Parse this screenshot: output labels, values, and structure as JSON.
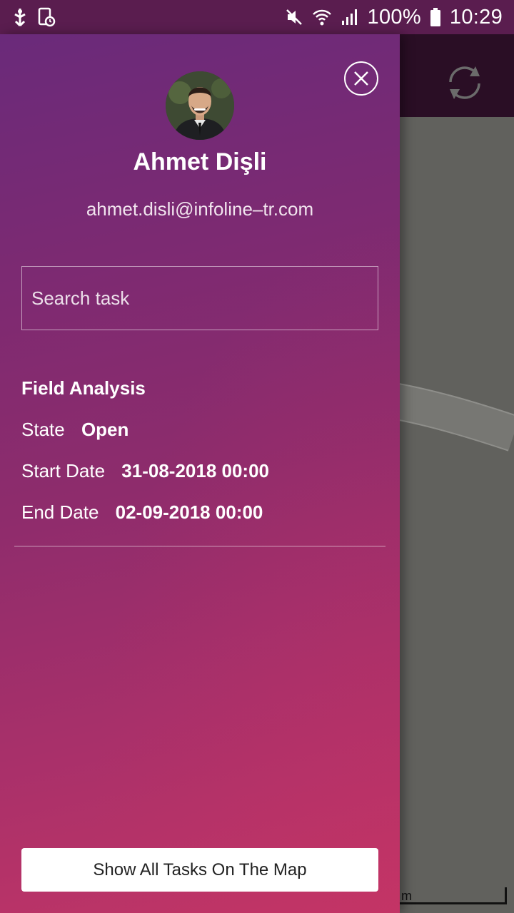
{
  "status_bar": {
    "battery_percent": "100%",
    "time": "10:29",
    "icons_left": [
      "usb-debug-icon",
      "screen-timer-icon"
    ],
    "icons_right": [
      "mute-icon",
      "wifi-icon",
      "signal-icon",
      "battery-icon"
    ]
  },
  "drawer": {
    "user": {
      "name": "Ahmet Dişli",
      "email": "ahmet.disli@infoline–tr.com"
    },
    "search": {
      "placeholder": "Search task"
    },
    "task": {
      "title": "Field Analysis",
      "state_label": "State",
      "state_value": "Open",
      "start_label": "Start Date",
      "start_value": "31-08-2018 00:00",
      "end_label": "End Date",
      "end_value": "02-09-2018 00:00"
    },
    "show_all_button": "Show All Tasks On The Map"
  },
  "map": {
    "scale_text": "m"
  },
  "colors": {
    "status_bar": "#5a1d4f",
    "drawer_top": "#6a2a7a",
    "drawer_bottom": "#c13566",
    "map_bg": "#61615d",
    "map_topbar": "#2a0e25"
  }
}
